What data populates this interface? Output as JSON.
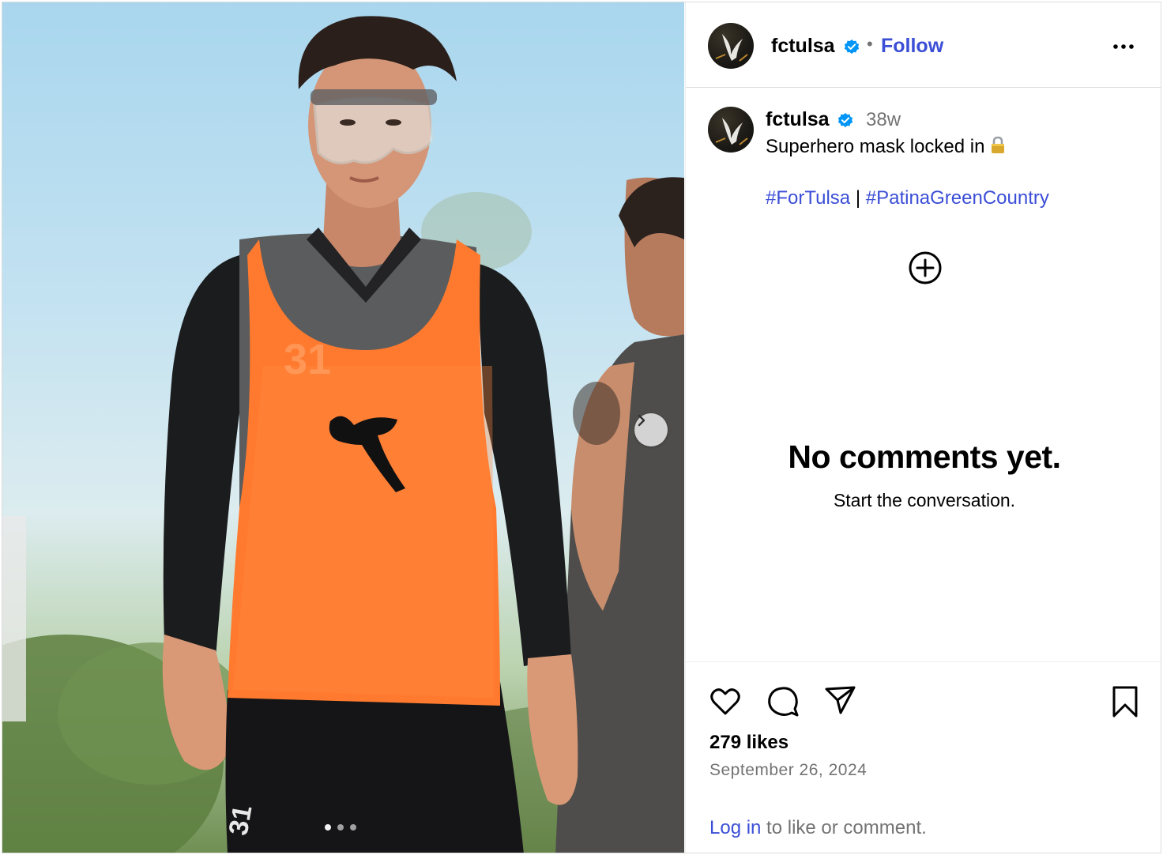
{
  "post": {
    "username": "fctulsa",
    "verified": true,
    "separator": "•",
    "follow_label": "Follow",
    "more_icon": "more-horizontal-icon"
  },
  "caption": {
    "username": "fctulsa",
    "time_ago": "38w",
    "text": "Superhero mask locked in",
    "emoji_icon": "lock-icon",
    "hashtag_1": "#ForTulsa",
    "divider": "|",
    "hashtag_2": "#PatinaGreenCountry"
  },
  "comments": {
    "add_icon": "plus-circle-icon",
    "empty_title": "No comments yet.",
    "empty_subtitle": "Start the conversation."
  },
  "media": {
    "carousel_dots": 3,
    "active_dot": 1,
    "next_icon": "chevron-right-icon",
    "jersey_number": "31"
  },
  "actions": {
    "like_icon": "heart-icon",
    "comment_icon": "comment-icon",
    "share_icon": "send-icon",
    "save_icon": "bookmark-icon",
    "likes_text": "279 likes",
    "date_text": "September 26, 2024",
    "login_link": "Log in",
    "login_rest": " to like or comment."
  },
  "colors": {
    "link_blue": "#3b4ed6",
    "verified_blue": "#0095f6",
    "muted_gray": "#737373",
    "bib_orange": "#ff7a2e"
  }
}
